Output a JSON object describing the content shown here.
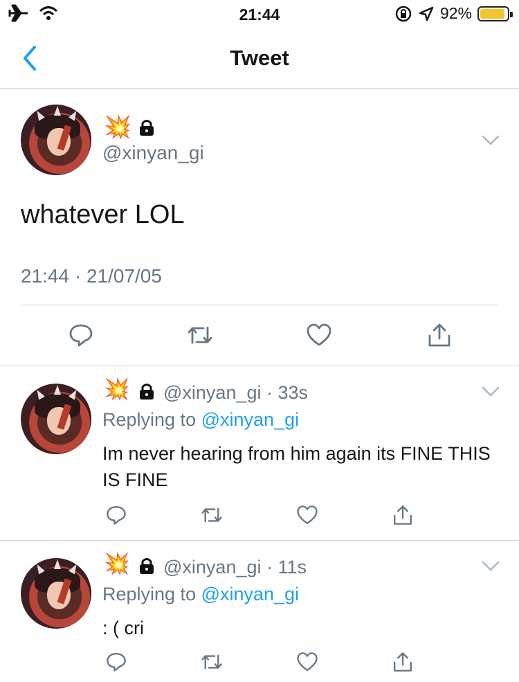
{
  "status_bar": {
    "time": "21:44",
    "battery_percent": "92%",
    "battery_level": 0.92,
    "icons": [
      "airplane-icon",
      "wifi-icon",
      "rotation-lock-icon",
      "location-icon",
      "battery-icon"
    ]
  },
  "nav": {
    "title": "Tweet",
    "back_icon": "chevron-left-icon"
  },
  "main_tweet": {
    "emoji": "💥",
    "handle": "@xinyan_gi",
    "text": "whatever LOL",
    "timestamp": "21:44 · 21/07/05"
  },
  "replies": [
    {
      "emoji": "💥",
      "handle_time": "@xinyan_gi · 33s",
      "replying_prefix": "Replying to ",
      "replying_to": "@xinyan_gi",
      "text": "Im never hearing from him again its FINE THIS IS FINE"
    },
    {
      "emoji": "💥",
      "handle_time": "@xinyan_gi · 11s",
      "replying_prefix": "Replying to ",
      "replying_to": "@xinyan_gi",
      "text": ": ( cri"
    }
  ],
  "colors": {
    "accent": "#1da1f2",
    "secondary_text": "#657786",
    "battery": "#f4c430"
  }
}
